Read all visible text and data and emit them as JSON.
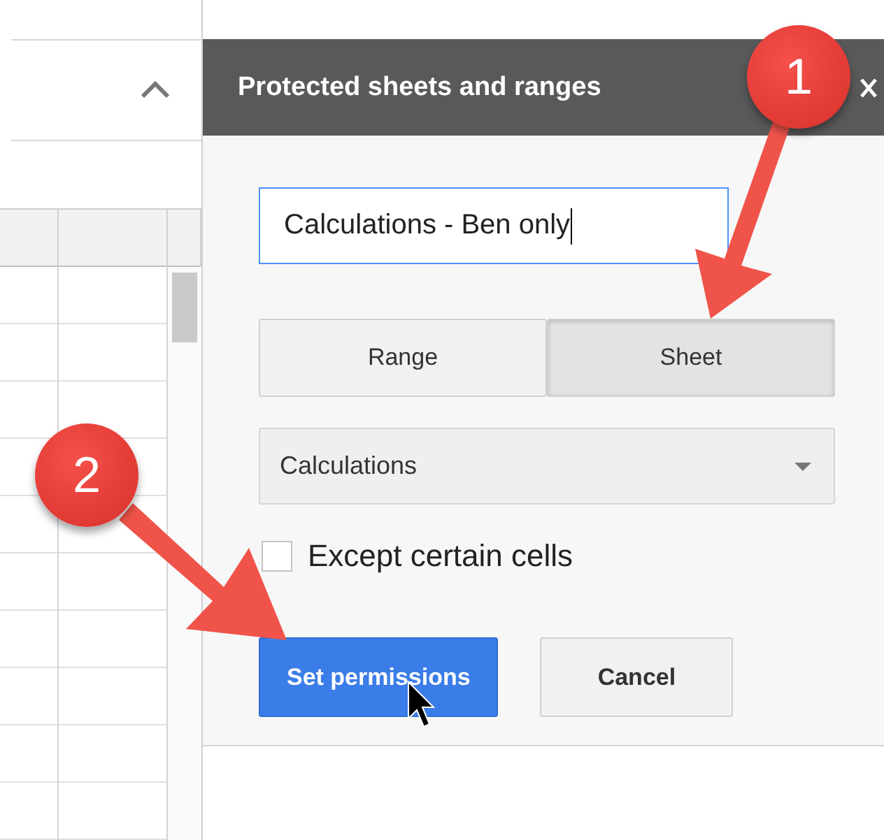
{
  "panel": {
    "title": "Protected sheets and ranges"
  },
  "name_field": {
    "value": "Calculations - Ben only"
  },
  "scope_toggle": [
    {
      "label": "Range",
      "selected": false
    },
    {
      "label": "Sheet",
      "selected": true
    }
  ],
  "sheet_dropdown": {
    "value": "Calculations"
  },
  "except_checkbox": {
    "label": "Except certain cells",
    "checked": false
  },
  "buttons": [
    {
      "label": "Set permissions",
      "kind": "primary"
    },
    {
      "label": "Cancel",
      "kind": "secondary"
    }
  ],
  "callouts": [
    {
      "label": "1"
    },
    {
      "label": "2"
    }
  ]
}
